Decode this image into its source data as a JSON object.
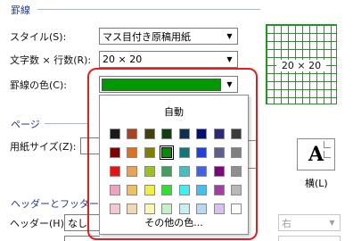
{
  "sections": {
    "ruled_lines": "罫線",
    "page": "ページ",
    "header_footer": "ヘッダーとフッター"
  },
  "fields": {
    "style_label": "スタイル(S):",
    "style_value": "マス目付き原稿用紙",
    "chars_lines_label": "文字数 × 行数(R):",
    "chars_lines_value": "20 × 20",
    "line_color_label": "罫線の色(C):",
    "line_color_value": "#009900",
    "paper_size_label": "用紙サイズ(Z):",
    "header_label": "ヘッダー(H):",
    "header_value": "なし",
    "header_align_value": "右"
  },
  "preview": {
    "grid_label": "20 × 20",
    "grid_color": "#1a9a1a"
  },
  "orientation": {
    "glyph": "A",
    "landscape_label": "横(L)"
  },
  "color_popup": {
    "automatic": "自動",
    "more_colors": "その他の色...",
    "selected_index": 11,
    "swatches": [
      "#1a1a1a",
      "#b0401a",
      "#404010",
      "#0f3f10",
      "#0f2f50",
      "#00107a",
      "#2a2a7a",
      "#3a3a3a",
      "#800000",
      "#e07020",
      "#808000",
      "#0a8a0a",
      "#107878",
      "#2040e0",
      "#606090",
      "#808080",
      "#ee1010",
      "#f0a050",
      "#a0c020",
      "#40a060",
      "#40c0c0",
      "#4060f0",
      "#800080",
      "#909090",
      "#f0a0c0",
      "#f0c060",
      "#f0f040",
      "#30e030",
      "#40f0f0",
      "#40c0f0",
      "#a040a0",
      "#b8b8b8",
      "#f4c8d0",
      "#f0d8b0",
      "#f8f8b0",
      "#c8f0c8",
      "#c8f0f0",
      "#b8d8f0",
      "#d8c0f0",
      "#ffffff"
    ]
  }
}
